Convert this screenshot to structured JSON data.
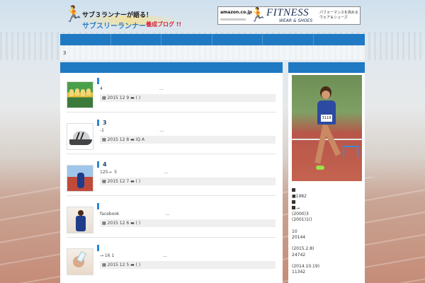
{
  "header": {
    "logo": {
      "line1": "サブ３ランナーが語る！",
      "line2": "サブスリーランナー",
      "line3": "養成ブログ !!"
    },
    "ad": {
      "brand": "amazon.co.jp",
      "title": "FITNESS",
      "subtitle": "WEAR & SHOES",
      "tagline": "パフォーマンスを高める ウェア＆シューズ"
    }
  },
  "nav": {
    "items": [
      "",
      "",
      "",
      "",
      "",
      ""
    ]
  },
  "breadcrumb": {
    "text": "3"
  },
  "posts": [
    {
      "title": "",
      "excerpt": "4                                          …",
      "date": "2015 12 9",
      "category": "( )"
    },
    {
      "title": "3",
      "excerpt": "-1                                         …",
      "date": "2015 12 8",
      "category": "iQ A"
    },
    {
      "title": "4",
      "excerpt": "125→  5                                   …",
      "date": "2015 12 7",
      "category": "( )"
    },
    {
      "title": "",
      "excerpt": "facebook                                  …",
      "date": "2015 12 6",
      "category": "( )"
    },
    {
      "title": "",
      "excerpt": "→ 16 1                                    …",
      "date": "2015 12 5",
      "category": "( )"
    }
  ],
  "sidebar": {
    "photo_bib": "3119",
    "profile": {
      "born": "■1982",
      "records": [
        "(2000)3",
        "(2001)1()"
      ],
      "stat1": [
        "10",
        "20144"
      ],
      "stat2": [
        "(2015.2.8)",
        "24742"
      ],
      "stat3": [
        "(2014.10.19)",
        "11342"
      ]
    }
  },
  "colors": {
    "nav": "#1f79c3",
    "post_title": "#1b3f7a",
    "logo_orange": "#e39a1a",
    "logo_blue": "#2f7dc6",
    "logo_red": "#d61f3c"
  }
}
